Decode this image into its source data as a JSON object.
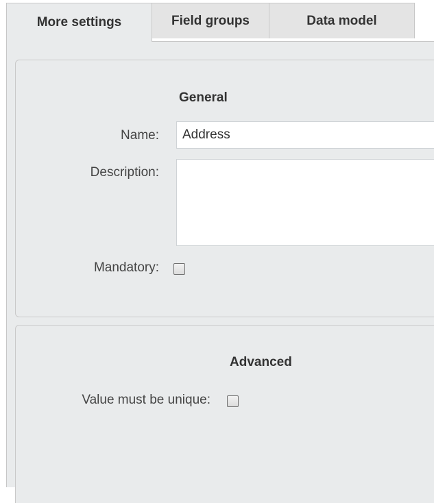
{
  "tabs": [
    {
      "label": "More settings",
      "active": true
    },
    {
      "label": "Field groups",
      "active": false
    },
    {
      "label": "Data model",
      "active": false
    }
  ],
  "general": {
    "title": "General",
    "name_label": "Name:",
    "name_value": "Address",
    "description_label": "Description:",
    "description_value": "",
    "mandatory_label": "Mandatory:",
    "mandatory_checked": false
  },
  "advanced": {
    "title": "Advanced",
    "unique_label": "Value must be unique:",
    "unique_checked": false
  },
  "colors": {
    "panel_background": "#e9ebec",
    "tab_background": "#e4e4e4",
    "border": "#c7c7c7"
  }
}
